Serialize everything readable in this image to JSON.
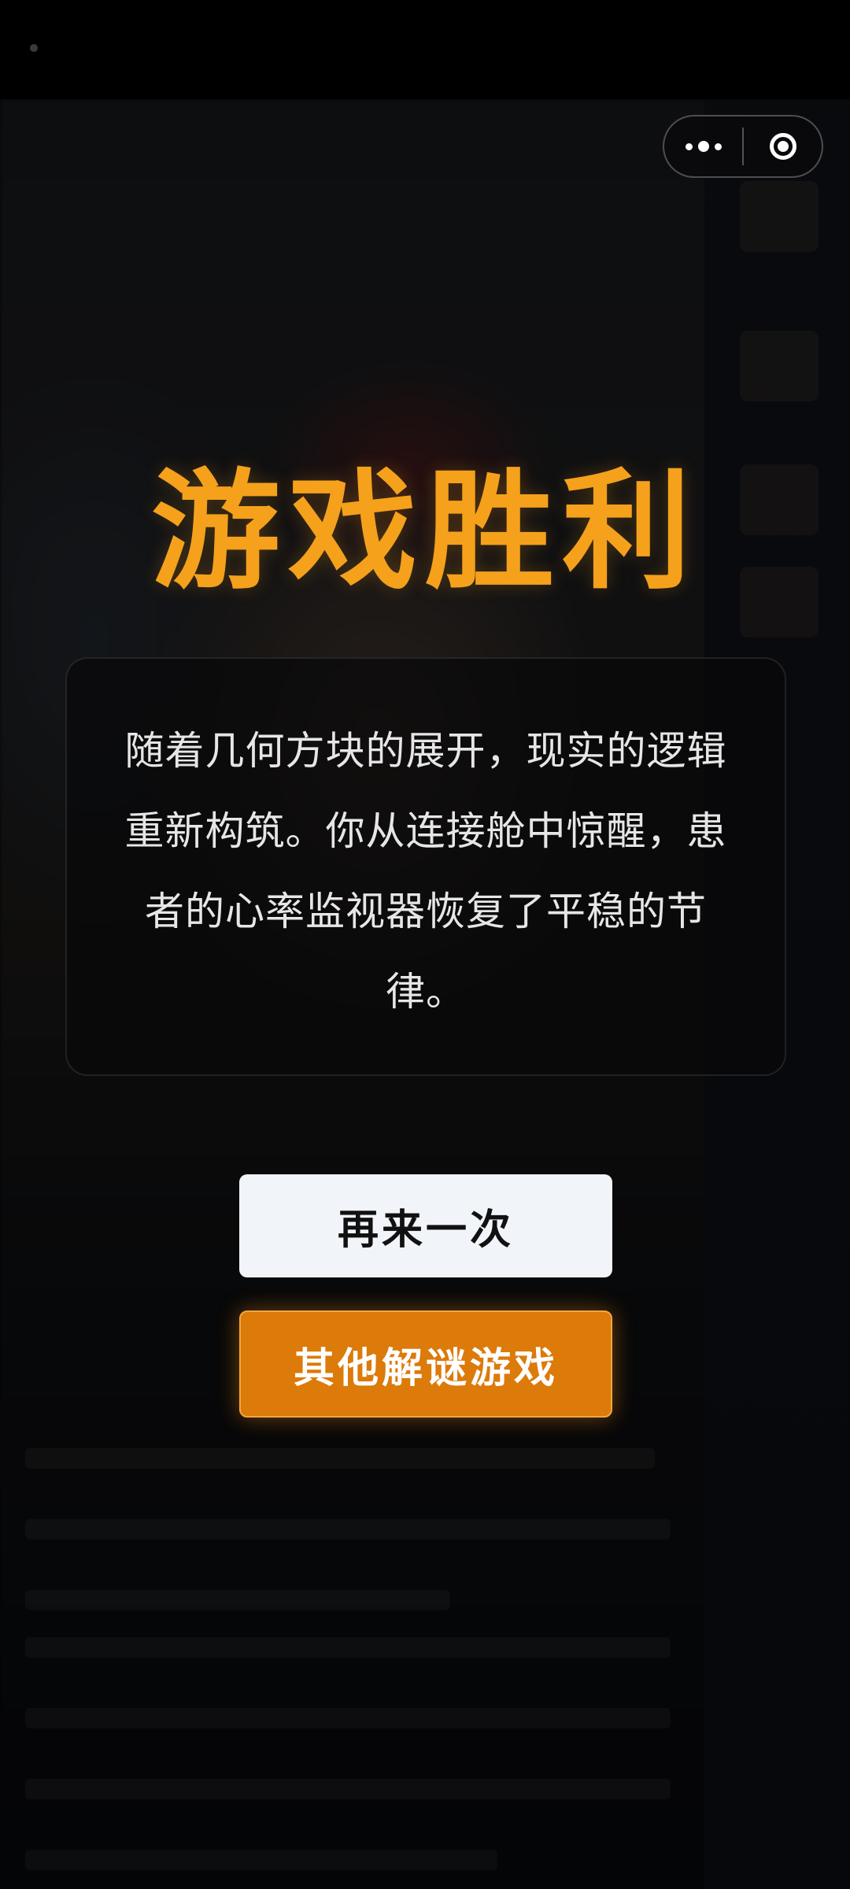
{
  "colors": {
    "title": "#f5a11c",
    "primary_button": "#dc7a0a",
    "secondary_button": "#f1f4f9",
    "card_background": "#0c0c0e"
  },
  "capsule": {
    "more_icon": "more-dots-icon",
    "close_icon": "mini-program-close-icon"
  },
  "result": {
    "title": "游戏胜利",
    "story": "随着几何方块的展开，现实的逻辑重新构筑。你从连接舱中惊醒，患者的心率监视器恢复了平稳的节律。"
  },
  "buttons": {
    "retry_label": "再来一次",
    "other_games_label": "其他解谜游戏"
  }
}
